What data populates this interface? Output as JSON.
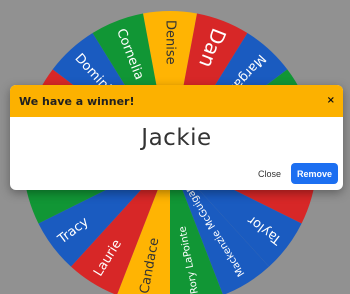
{
  "wheel": {
    "segments": [
      {
        "label": "Denise",
        "color": "#ffb403"
      },
      {
        "label": "Dan",
        "color": "#d72727"
      },
      {
        "label": "Margaret",
        "color": "#1a5bc0"
      },
      {
        "label": "",
        "color": "#119635"
      },
      {
        "label": "",
        "color": "#ffb403"
      },
      {
        "label": "",
        "color": "#d72727"
      },
      {
        "label": "Taylor",
        "color": "#1a5bc0"
      },
      {
        "label": "Mackenzie McGuigan",
        "color": "#1a5bc0"
      },
      {
        "label": "Rory LaPointe",
        "color": "#119635"
      },
      {
        "label": "Candace",
        "color": "#ffb403"
      },
      {
        "label": "Laurie",
        "color": "#d72727"
      },
      {
        "label": "Tracy",
        "color": "#1a5bc0"
      },
      {
        "label": "",
        "color": "#119635"
      },
      {
        "label": "",
        "color": "#ffb403"
      },
      {
        "label": "",
        "color": "#d72727"
      },
      {
        "label": "Dominik",
        "color": "#1a5bc0"
      },
      {
        "label": "Cornelia",
        "color": "#119635"
      }
    ]
  },
  "modal": {
    "title": "We have a winner!",
    "close_icon": "×",
    "winner": "Jackie",
    "close_label": "Close",
    "remove_label": "Remove"
  },
  "colors": {
    "backdrop": "#919191",
    "header": "#fcb100",
    "remove_button": "#1c6ff1"
  }
}
